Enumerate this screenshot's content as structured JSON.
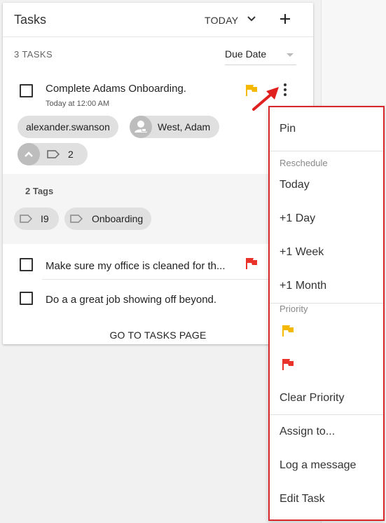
{
  "header": {
    "title": "Tasks",
    "filter_label": "TODAY",
    "add_icon": "plus-icon",
    "filter_icon": "chevron-down-icon"
  },
  "toolbar": {
    "count_label": "3 TASKS",
    "sort_label": "Due Date"
  },
  "tasks": [
    {
      "title": "Complete Adams Onboarding.",
      "due": "Today at 12:00 AM",
      "priority_color": "#f5b800",
      "chips": [
        {
          "label": "alexander.swanson"
        },
        {
          "label": "West, Adam",
          "icon": "person-icon"
        }
      ],
      "tag_count": "2"
    },
    {
      "title": "Make sure my office is cleaned for th...",
      "priority_color": "#e8322a"
    },
    {
      "title": "Do a a great job showing off beyond."
    }
  ],
  "tags_panel": {
    "title": "2 Tags",
    "tags": [
      "I9",
      "Onboarding"
    ]
  },
  "footer": {
    "goto_label": "GO TO TASKS PAGE"
  },
  "menu": {
    "pin": "Pin",
    "reschedule_title": "Reschedule",
    "reschedule": [
      "Today",
      "+1 Day",
      "+1 Week",
      "+1 Month"
    ],
    "priority_title": "Priority",
    "priority_colors": [
      "#f5b800",
      "#e8322a"
    ],
    "clear_priority": "Clear Priority",
    "assign": "Assign to...",
    "log_message": "Log a message",
    "edit_task": "Edit Task"
  },
  "annotation": {
    "border_color": "#d8262c",
    "arrow_color": "#e0201e"
  }
}
